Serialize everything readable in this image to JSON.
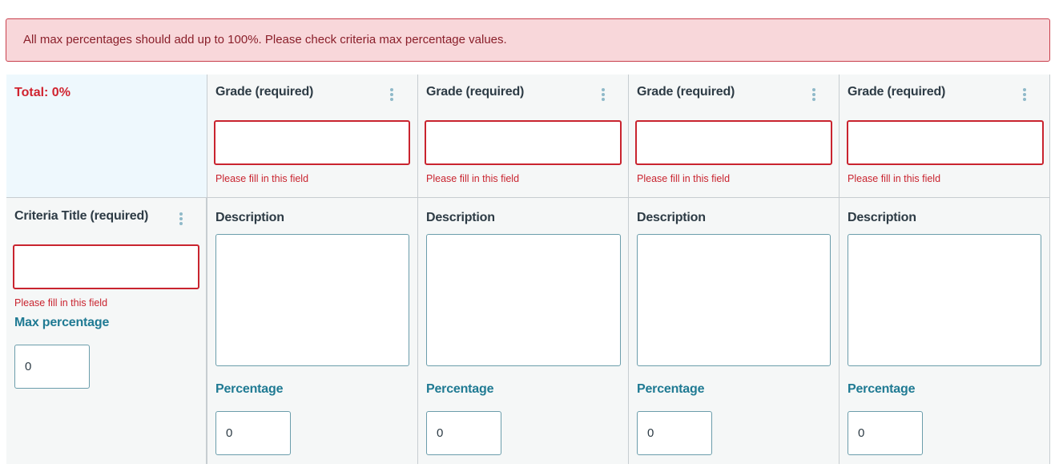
{
  "alert": {
    "message": "All max percentages should add up to 100%. Please check criteria max percentage values."
  },
  "total": {
    "label": "Total: 0%"
  },
  "grades": [
    {
      "title": "Grade (required)",
      "value": "",
      "error": "Please fill in this field"
    },
    {
      "title": "Grade (required)",
      "value": "",
      "error": "Please fill in this field"
    },
    {
      "title": "Grade (required)",
      "value": "",
      "error": "Please fill in this field"
    },
    {
      "title": "Grade (required)",
      "value": "",
      "error": "Please fill in this field"
    }
  ],
  "criteria": {
    "title": "Criteria Title (required)",
    "value": "",
    "error": "Please fill in this field",
    "max_label": "Max percentage",
    "max_value": "0"
  },
  "levels": [
    {
      "desc_label": "Description",
      "desc_value": "",
      "pct_label": "Percentage",
      "pct_value": "0"
    },
    {
      "desc_label": "Description",
      "desc_value": "",
      "pct_label": "Percentage",
      "pct_value": "0"
    },
    {
      "desc_label": "Description",
      "desc_value": "",
      "pct_label": "Percentage",
      "pct_value": "0"
    },
    {
      "desc_label": "Description",
      "desc_value": "",
      "pct_label": "Percentage",
      "pct_value": "0"
    }
  ],
  "colors": {
    "error": "#c9242f",
    "accent": "#1f7a93",
    "alert_bg": "#f8d7da"
  }
}
